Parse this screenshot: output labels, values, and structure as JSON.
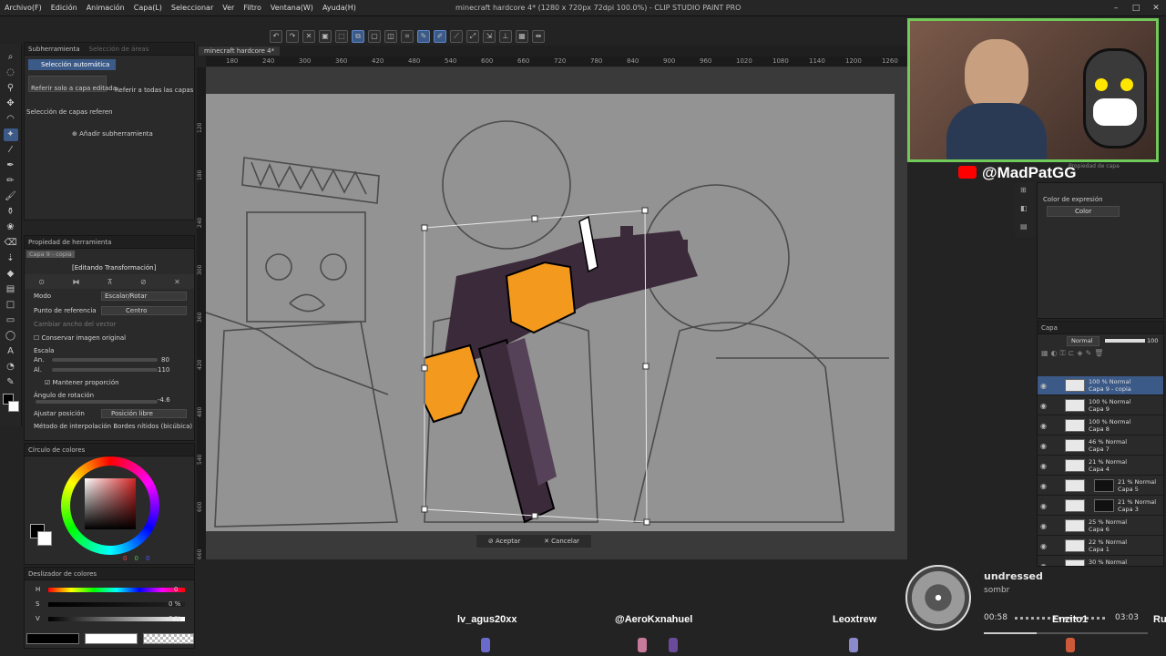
{
  "window": {
    "title": "minecraft hardcore 4* (1280 x 720px 72dpi 100.0%)  - CLIP STUDIO PAINT PRO",
    "controls": [
      "–",
      "□",
      "✕"
    ]
  },
  "menu": [
    "Archivo(F)",
    "Edición",
    "Animación",
    "Capa(L)",
    "Seleccionar",
    "Ver",
    "Filtro",
    "Ventana(W)",
    "Ayuda(H)"
  ],
  "subtool": {
    "tabs": [
      "Subherramienta",
      "Selección de áreas"
    ],
    "active": "Selección automática",
    "options": [
      "Referir solo a capa editada",
      "Referir a todas las capas",
      "Selección de capas referen"
    ],
    "add_label": "Añadir subherramienta"
  },
  "tool_property": {
    "tab": "Propiedad de herramienta",
    "layer_badge": "Capa 9 - copia",
    "status": "[Editando Transformación]",
    "mode_label": "Modo",
    "mode_value": "Escalar/Rotar",
    "ref_label": "Punto de referencia",
    "ref_value": "Centro",
    "vector_label": "Cambiar ancho del vector",
    "keep_original_label": "Conservar imagen original",
    "scale_label": "Escala",
    "width_label": "An.",
    "width_value": "80",
    "height_label": "Al.",
    "height_value": "110",
    "keep_ratio_label": "Mantener proporción",
    "angle_label": "Ángulo de rotación",
    "angle_value": "-4.6",
    "fit_label": "Ajustar posición",
    "fit_value": "Posición libre",
    "interp_label": "Método de interpolación",
    "interp_value": "Bordes nítidos (bicúbica)"
  },
  "color_panel": {
    "tab": "Círculo de colores",
    "values": [
      "0",
      "0",
      "0"
    ]
  },
  "color_slider": {
    "tab": "Deslizador de colores",
    "channels": [
      {
        "label": "H",
        "value": "0"
      },
      {
        "label": "S",
        "value": "0 %"
      },
      {
        "label": "V",
        "value": "0 %"
      }
    ]
  },
  "canvas": {
    "tab": "minecraft hardcore 4*",
    "ruler": [
      "180",
      "240",
      "300",
      "360",
      "420",
      "480",
      "540",
      "600",
      "660",
      "720",
      "780",
      "840",
      "900",
      "960",
      "1020",
      "1080",
      "1140",
      "1200",
      "1260"
    ],
    "ruler_left": [
      "120",
      "180",
      "240",
      "300",
      "360",
      "420",
      "480",
      "540",
      "600",
      "660"
    ],
    "accept_label": "Aceptar",
    "cancel_label": "Cancelar"
  },
  "overlay": {
    "handle": "@MadPatGG",
    "viewers": [
      "lv_agus20xx",
      "@AeroKxnahuel",
      "Leoxtrew",
      "Enzito1",
      "Ru"
    ],
    "song_title": "undressed",
    "song_artist": "sombr",
    "time_elapsed": "00:58",
    "time_total": "03:03"
  },
  "expression_panel": {
    "tab": "Propiedad de capa",
    "label": "Color de expresión",
    "value": "Color"
  },
  "layers_panel": {
    "tab": "Capa",
    "blend": "Normal",
    "opacity": "100",
    "layers": [
      {
        "mode": "100 % Normal",
        "name": "Capa 9 - copia",
        "selected": true,
        "mask": false
      },
      {
        "mode": "100 % Normal",
        "name": "Capa 9",
        "selected": false,
        "mask": false
      },
      {
        "mode": "100 % Normal",
        "name": "Capa 8",
        "selected": false,
        "mask": false
      },
      {
        "mode": "46 % Normal",
        "name": "Capa 7",
        "selected": false,
        "mask": false
      },
      {
        "mode": "21 % Normal",
        "name": "Capa 4",
        "selected": false,
        "mask": false
      },
      {
        "mode": "21 % Normal",
        "name": "Capa 5",
        "selected": false,
        "mask": true
      },
      {
        "mode": "21 % Normal",
        "name": "Capa 3",
        "selected": false,
        "mask": true
      },
      {
        "mode": "25 % Normal",
        "name": "Capa 6",
        "selected": false,
        "mask": false
      },
      {
        "mode": "22 % Normal",
        "name": "Capa 1",
        "selected": false,
        "mask": false
      },
      {
        "mode": "30 % Normal",
        "name": "",
        "selected": false,
        "mask": false
      }
    ]
  },
  "colors": {
    "accent": "#3c5a88",
    "gun_orange": "#f39a1e",
    "gun_dark": "#3b2a3a",
    "webcam_border": "#71c95a"
  }
}
